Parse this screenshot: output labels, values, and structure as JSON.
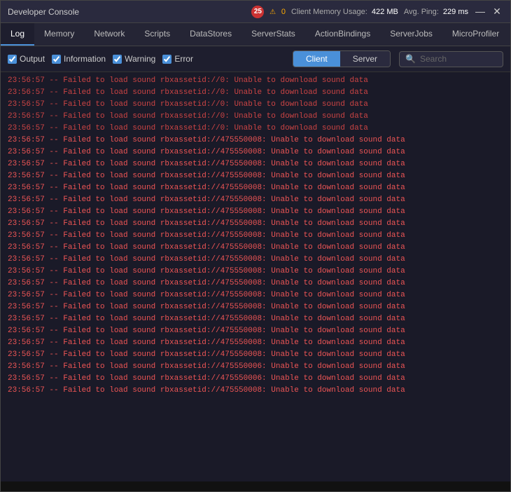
{
  "titleBar": {
    "title": "Developer Console",
    "errorCount": "25",
    "warningCount": "0",
    "memoryLabel": "Client Memory Usage:",
    "memoryValue": "422 MB",
    "pingLabel": "Avg. Ping:",
    "pingValue": "229 ms",
    "minimizeBtn": "—",
    "closeBtn": "✕"
  },
  "nav": {
    "tabs": [
      {
        "label": "Log",
        "active": true
      },
      {
        "label": "Memory",
        "active": false
      },
      {
        "label": "Network",
        "active": false
      },
      {
        "label": "Scripts",
        "active": false
      },
      {
        "label": "DataStores",
        "active": false
      },
      {
        "label": "ServerStats",
        "active": false
      },
      {
        "label": "ActionBindings",
        "active": false
      },
      {
        "label": "ServerJobs",
        "active": false
      },
      {
        "label": "MicroProfiler",
        "active": false
      }
    ]
  },
  "toolbar": {
    "outputLabel": "Output",
    "infoLabel": "Information",
    "warningLabel": "Warning",
    "errorLabel": "Error",
    "clientBtn": "Client",
    "serverBtn": "Server",
    "searchPlaceholder": "Search"
  },
  "log": {
    "lines": [
      "23:56:57  -- Failed to load sound rbxassetid://0: Unable to download sound data",
      "23:56:57  -- Failed to load sound rbxassetid://0: Unable to download sound data",
      "23:56:57  -- Failed to load sound rbxassetid://0: Unable to download sound data",
      "23:56:57  -- Failed to load sound rbxassetid://0: Unable to download sound data",
      "23:56:57  -- Failed to load sound rbxassetid://0: Unable to download sound data",
      "23:56:57  -- Failed to load sound rbxassetid://475550008: Unable to download sound data",
      "23:56:57  -- Failed to load sound rbxassetid://475550008: Unable to download sound data",
      "23:56:57  -- Failed to load sound rbxassetid://475550008: Unable to download sound data",
      "23:56:57  -- Failed to load sound rbxassetid://475550008: Unable to download sound data",
      "23:56:57  -- Failed to load sound rbxassetid://475550008: Unable to download sound data",
      "23:56:57  -- Failed to load sound rbxassetid://475550008: Unable to download sound data",
      "23:56:57  -- Failed to load sound rbxassetid://475550008: Unable to download sound data",
      "23:56:57  -- Failed to load sound rbxassetid://475550008: Unable to download sound data",
      "23:56:57  -- Failed to load sound rbxassetid://475550008: Unable to download sound data",
      "23:56:57  -- Failed to load sound rbxassetid://475550008: Unable to download sound data",
      "23:56:57  -- Failed to load sound rbxassetid://475550008: Unable to download sound data",
      "23:56:57  -- Failed to load sound rbxassetid://475550008: Unable to download sound data",
      "23:56:57  -- Failed to load sound rbxassetid://475550008: Unable to download sound data",
      "23:56:57  -- Failed to load sound rbxassetid://475550008: Unable to download sound data",
      "23:56:57  -- Failed to load sound rbxassetid://475550008: Unable to download sound data",
      "23:56:57  -- Failed to load sound rbxassetid://475550008: Unable to download sound data",
      "23:56:57  -- Failed to load sound rbxassetid://475550008: Unable to download sound data",
      "23:56:57  -- Failed to load sound rbxassetid://475550008: Unable to download sound data",
      "23:56:57  -- Failed to load sound rbxassetid://475550008: Unable to download sound data",
      "23:56:57  -- Failed to load sound rbxassetid://475550006: Unable to download sound data",
      "23:56:57  -- Failed to load sound rbxassetid://475550006: Unable to download sound data",
      "23:56:57  -- Failed to load sound rbxassetid://475550008: Unable to download sound data"
    ]
  }
}
